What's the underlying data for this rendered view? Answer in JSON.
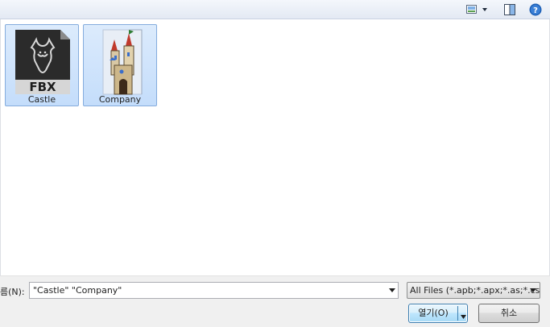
{
  "toolbar": {
    "view_menu_icon": "view-menu-icon",
    "preview_pane_icon": "preview-pane-icon",
    "help_icon": "help-icon"
  },
  "files": [
    {
      "name": "Castle",
      "icon": "fbx-file-icon",
      "badge": "FBX"
    },
    {
      "name": "Company",
      "icon": "castle-thumbnail"
    }
  ],
  "bottom": {
    "filename_label": "름(N):",
    "filename_value": "\"Castle\" \"Company\"",
    "filetype_value": "All Files (*.apb;*.apx;*.as;*.csv;*",
    "open_label": "열기(O)",
    "cancel_label": "취소"
  },
  "colors": {
    "selection_fill": "#cce8ff",
    "selection_border": "#84acdd",
    "primary_button_border": "#3c7fb1"
  }
}
